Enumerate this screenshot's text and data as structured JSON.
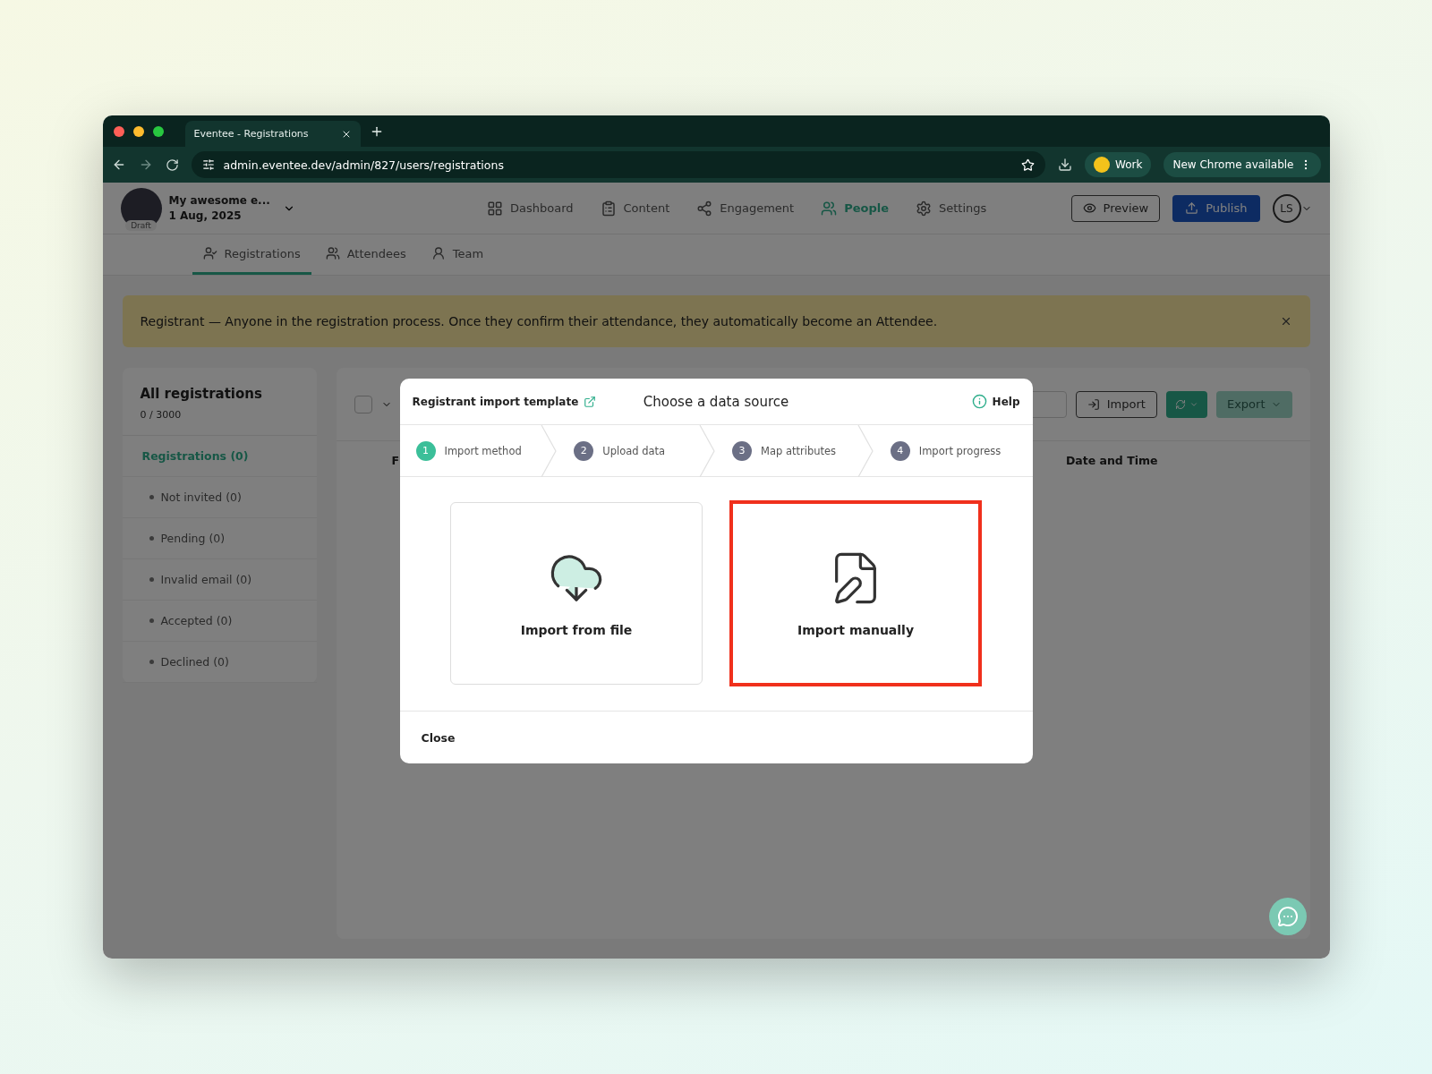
{
  "browser": {
    "tab_title": "Eventee - Registrations",
    "url": "admin.eventee.dev/admin/827/users/registrations",
    "profile": "Work",
    "update_notice": "New Chrome available"
  },
  "header": {
    "status_badge": "Draft",
    "event_name": "My awesome e...",
    "event_date": "1 Aug, 2025",
    "nav": [
      {
        "label": "Dashboard",
        "selected": false
      },
      {
        "label": "Content",
        "selected": false
      },
      {
        "label": "Engagement",
        "selected": false
      },
      {
        "label": "People",
        "selected": true
      },
      {
        "label": "Settings",
        "selected": false
      }
    ],
    "preview": "Preview",
    "publish": "Publish",
    "user_initials": "LS"
  },
  "subtabs": [
    {
      "label": "Registrations",
      "selected": true
    },
    {
      "label": "Attendees",
      "selected": false
    },
    {
      "label": "Team",
      "selected": false
    }
  ],
  "banner": {
    "text": "Registrant — Anyone in the registration process. Once they confirm their attendance, they automatically become an Attendee."
  },
  "sidebar": {
    "title": "All registrations",
    "count": "0 / 3000",
    "items": [
      {
        "label": "Registrations (0)",
        "selected": true,
        "children": [
          {
            "label": "Not invited (0)",
            "selected": false
          },
          {
            "label": "Pending (0)",
            "selected": false
          },
          {
            "label": "Invalid email (0)",
            "selected": false
          },
          {
            "label": "Accepted (0)",
            "selected": false
          },
          {
            "label": "Declined (0)",
            "selected": false
          }
        ]
      }
    ]
  },
  "toolbar": {
    "select_all": {
      "checked": false
    },
    "import": "Import",
    "export": {
      "label": "Export",
      "disabled": true
    }
  },
  "table": {
    "columns": [
      "F",
      "Date and Time"
    ]
  },
  "modal": {
    "template_link": "Registrant import template",
    "title": "Choose a data source",
    "help": "Help",
    "steps": [
      {
        "number": "1",
        "label": "Import method",
        "selected": true
      },
      {
        "number": "2",
        "label": "Upload data",
        "selected": false
      },
      {
        "number": "3",
        "label": "Map attributes",
        "selected": false
      },
      {
        "number": "4",
        "label": "Import progress",
        "selected": false
      }
    ],
    "options": [
      {
        "label": "Import from file",
        "kind": "file",
        "highlighted": false
      },
      {
        "label": "Import manually",
        "kind": "manual",
        "highlighted": true
      }
    ],
    "close": "Close"
  }
}
